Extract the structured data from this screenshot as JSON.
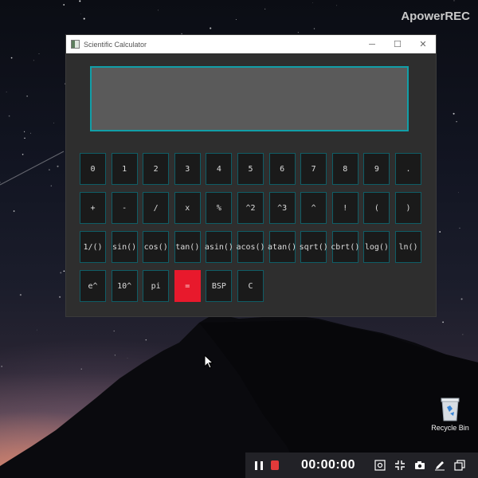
{
  "watermark": "ApowerREC",
  "window": {
    "title": "Scientific Calculator",
    "controls": {
      "minimize": "─",
      "maximize": "☐",
      "close": "✕"
    }
  },
  "display": {
    "value": ""
  },
  "keys": [
    [
      "0",
      "1",
      "2",
      "3",
      "4",
      "5",
      "6",
      "7",
      "8",
      "9",
      "."
    ],
    [
      "+",
      "-",
      "/",
      "x",
      "%",
      "^2",
      "^3",
      "^",
      "!",
      "(",
      ")"
    ],
    [
      "1/()",
      "sin()",
      "cos()",
      "tan()",
      "asin()",
      "acos()",
      "atan()",
      "sqrt()",
      "cbrt()",
      "log()",
      "ln()"
    ],
    [
      "e^",
      "10^",
      "pi",
      "=",
      "BSP",
      "C"
    ]
  ],
  "desktop": {
    "recycle_bin_label": "Recycle Bin"
  },
  "recorder": {
    "timer": "00:00:00"
  },
  "colors": {
    "accent": "#119fa8",
    "equals_key": "#e8192c",
    "record": "#e23a3a"
  }
}
